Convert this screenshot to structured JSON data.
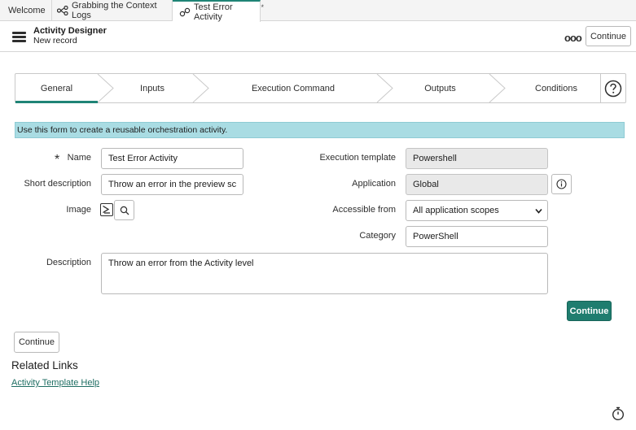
{
  "tabs": [
    {
      "label": "Welcome",
      "icon": null,
      "active": false
    },
    {
      "label": "Grabbing the Context Logs",
      "icon": "flow-icon",
      "active": false
    },
    {
      "label": "Test Error Activity",
      "icon": "link-icon",
      "active": true,
      "modified_marker": "*"
    }
  ],
  "header": {
    "title": "Activity Designer",
    "subtitle": "New record",
    "more_label": "ooo",
    "continue_label": "Continue"
  },
  "process_flow": {
    "steps": [
      "General",
      "Inputs",
      "Execution Command",
      "Outputs",
      "Conditions"
    ],
    "active_index": 0
  },
  "info_message": "Use this form to create a reusable orchestration activity.",
  "form": {
    "required_marker": "*",
    "name": {
      "label": "Name",
      "value": "Test Error Activity"
    },
    "short_description": {
      "label": "Short description",
      "value": "Throw an error in the preview script"
    },
    "image": {
      "label": "Image"
    },
    "execution_template": {
      "label": "Execution template",
      "value": "Powershell"
    },
    "application": {
      "label": "Application",
      "value": "Global"
    },
    "accessible_from": {
      "label": "Accessible from",
      "value": "All application scopes",
      "options": [
        "All application scopes"
      ]
    },
    "category": {
      "label": "Category",
      "value": "PowerShell"
    },
    "description": {
      "label": "Description",
      "value": "Throw an error from the Activity level"
    }
  },
  "buttons": {
    "continue_primary": "Continue",
    "continue_bottom": "Continue"
  },
  "related_links": {
    "title": "Related Links",
    "links": [
      "Activity Template Help"
    ]
  },
  "colors": {
    "accent": "#1f8476",
    "primary_button": "#1f7d6f",
    "info_bg": "#a9dce3"
  }
}
